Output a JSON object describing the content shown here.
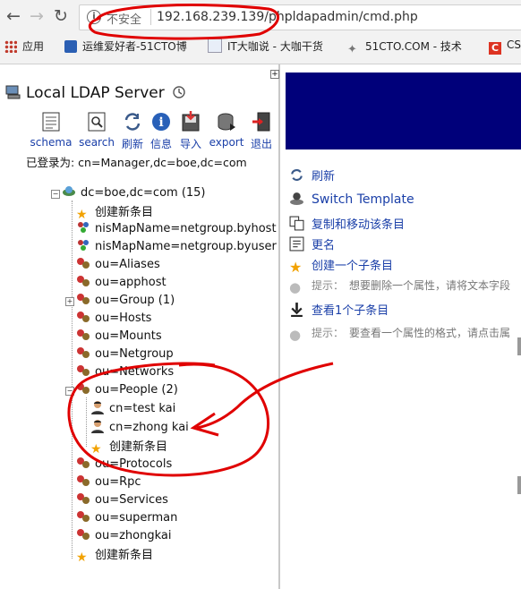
{
  "browser": {
    "url": "192.168.239.139/phpldapadmin/cmd.php",
    "security_label": "不安全",
    "bookmarks": [
      "应用",
      "运维爱好者-51CTO博",
      "IT大咖说 - 大咖干货",
      "51CTO.COM - 技术",
      "CS"
    ]
  },
  "left_panel": {
    "server_title": "Local LDAP Server",
    "toolbar": [
      "schema",
      "search",
      "刷新",
      "信息",
      "导入",
      "export",
      "退出"
    ],
    "logged_in_as": "已登录为: cn=Manager,dc=boe,dc=com",
    "tree": {
      "root": "dc=boe,dc=com (15)",
      "items": [
        {
          "label": "创建新条目",
          "icon": "star-icon"
        },
        {
          "label": "nisMapName=netgroup.byhost",
          "icon": "group-icon"
        },
        {
          "label": "nisMapName=netgroup.byuser",
          "icon": "group-icon"
        },
        {
          "label": "ou=Aliases",
          "icon": "ou-icon"
        },
        {
          "label": "ou=apphost",
          "icon": "ou-icon"
        },
        {
          "label": "ou=Group (1)",
          "icon": "ou-icon"
        },
        {
          "label": "ou=Hosts",
          "icon": "ou-icon"
        },
        {
          "label": "ou=Mounts",
          "icon": "ou-icon"
        },
        {
          "label": "ou=Netgroup",
          "icon": "ou-icon"
        },
        {
          "label": "ou=Networks",
          "icon": "ou-icon"
        },
        {
          "label": "ou=People (2)",
          "icon": "ou-icon"
        },
        {
          "label": "ou=Protocols",
          "icon": "ou-icon"
        },
        {
          "label": "ou=Rpc",
          "icon": "ou-icon"
        },
        {
          "label": "ou=Services",
          "icon": "ou-icon"
        },
        {
          "label": "ou=superman",
          "icon": "ou-icon"
        },
        {
          "label": "ou=zhongkai",
          "icon": "ou-icon"
        },
        {
          "label": "创建新条目",
          "icon": "star-icon"
        }
      ],
      "people_children": [
        {
          "label": "cn=test kai",
          "icon": "user-icon"
        },
        {
          "label": "cn=zhong kai",
          "icon": "user-icon"
        },
        {
          "label": "创建新条目",
          "icon": "star-icon"
        }
      ]
    }
  },
  "right_panel": {
    "actions": [
      {
        "label": "刷新",
        "icon": "refresh-icon"
      },
      {
        "label": "Switch Template",
        "icon": "template-icon"
      },
      {
        "label": "复制和移动该条目",
        "icon": "copy-icon"
      },
      {
        "label": "更名",
        "icon": "rename-icon"
      },
      {
        "label": "创建一个子条目",
        "icon": "star-icon"
      }
    ],
    "hint1_label": "提示：",
    "hint1_text": "想要删除一个属性，请将文本字段",
    "view_children": "查看1个子条目",
    "hint2_label": "提示：",
    "hint2_text": "要查看一个属性的格式，请点击属"
  },
  "colors": {
    "banner": "#00007a",
    "link": "#1a3fa8",
    "annotation": "#e00000"
  }
}
